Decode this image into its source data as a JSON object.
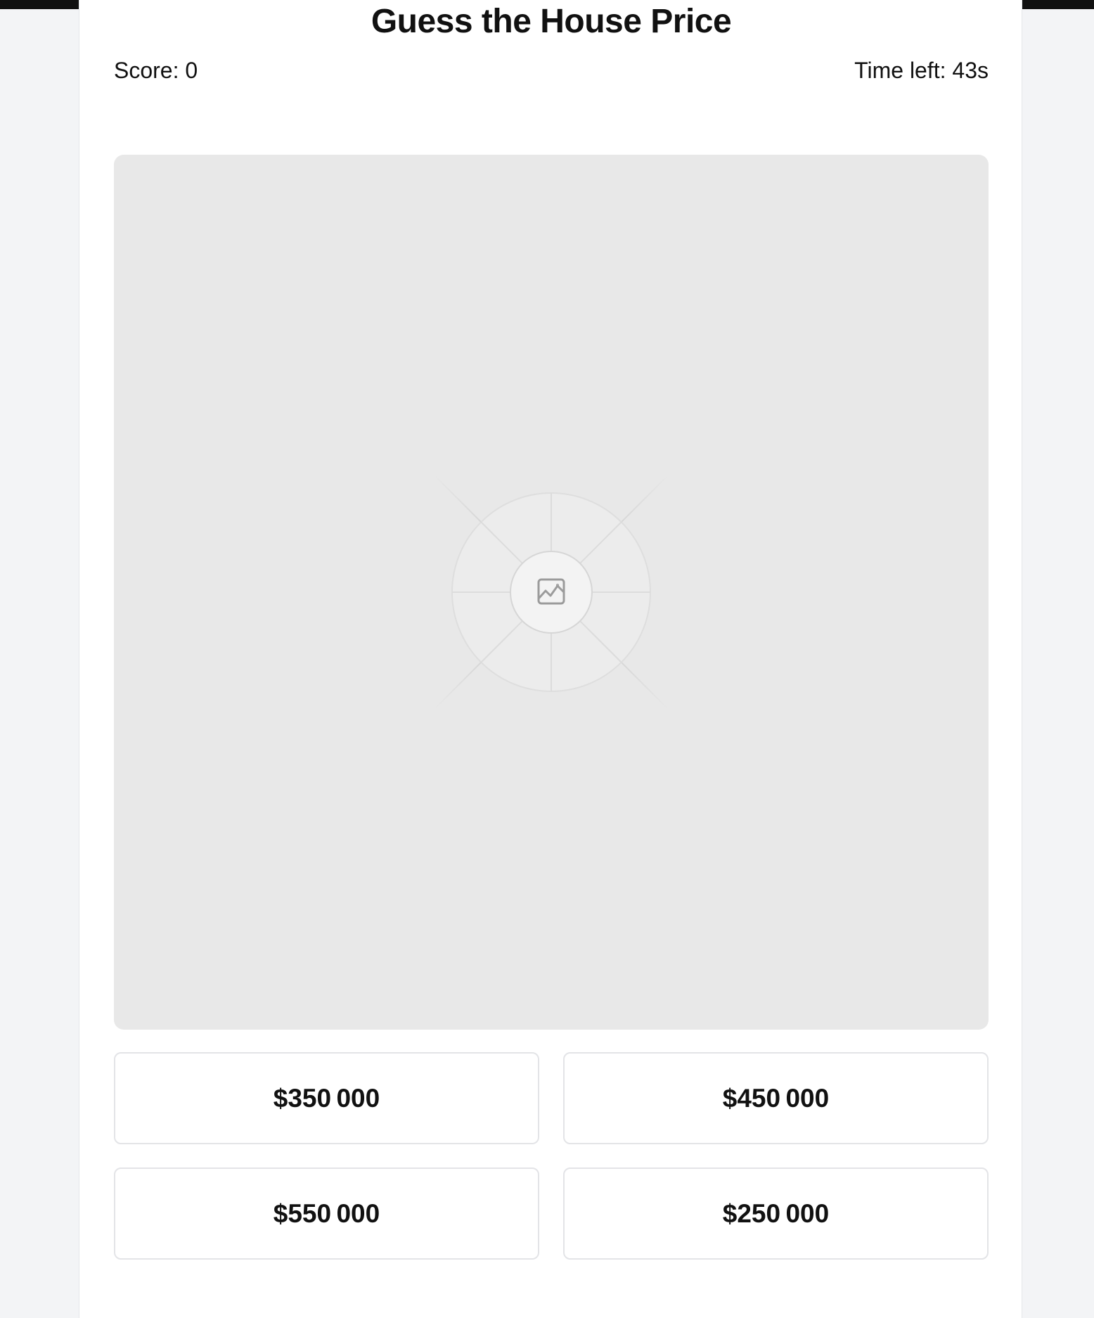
{
  "game": {
    "title": "Guess the House Price",
    "score_text": "Score: 0",
    "time_text": "Time left: 43s"
  },
  "image": {
    "icon": "image-placeholder-icon"
  },
  "options": [
    {
      "label": "$350 000"
    },
    {
      "label": "$450 000"
    },
    {
      "label": "$550 000"
    },
    {
      "label": "$250 000"
    }
  ],
  "colors": {
    "page_background": "#f3f4f6",
    "card_background": "#ffffff",
    "image_background": "#e8e8e8",
    "text": "#111111",
    "button_border": "#e3e4e7"
  }
}
